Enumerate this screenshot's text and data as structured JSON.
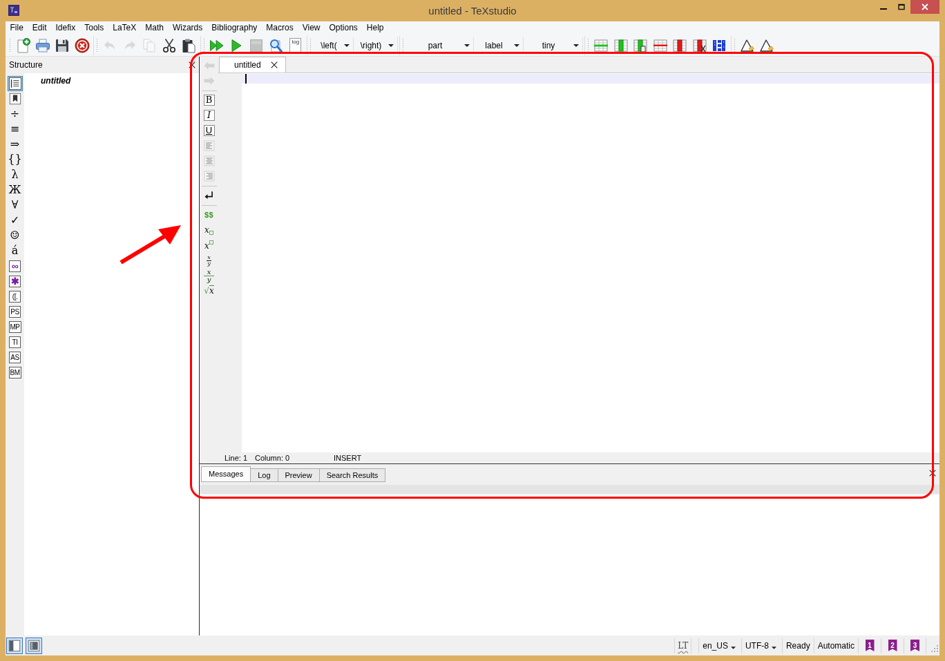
{
  "window": {
    "title": "untitled - TeXstudio"
  },
  "menu": [
    "File",
    "Edit",
    "Idefix",
    "Tools",
    "LaTeX",
    "Math",
    "Wizards",
    "Bibliography",
    "Macros",
    "View",
    "Options",
    "Help"
  ],
  "toolbar": [
    {
      "buttons": [
        {
          "kind": "new",
          "disabled": false
        },
        {
          "kind": "print",
          "disabled": false
        },
        {
          "kind": "save",
          "disabled": false
        },
        {
          "kind": "close",
          "disabled": false
        }
      ]
    },
    {
      "buttons": [
        {
          "kind": "undo",
          "disabled": true
        },
        {
          "kind": "redo",
          "disabled": true
        },
        {
          "kind": "copy",
          "disabled": true
        },
        {
          "kind": "cut",
          "disabled": false
        },
        {
          "kind": "paste",
          "disabled": false
        }
      ]
    },
    {
      "buttons": [
        {
          "kind": "compile",
          "disabled": false
        },
        {
          "kind": "build",
          "disabled": false
        },
        {
          "kind": "stop",
          "disabled": true
        },
        {
          "kind": "view",
          "disabled": false
        },
        {
          "kind": "log",
          "text": "log",
          "disabled": false
        }
      ]
    },
    {
      "dropdowns": [
        "\\left(",
        "\\right)"
      ]
    },
    {
      "dropdowns": [
        "part",
        "label",
        "tiny"
      ]
    },
    {
      "buttons": [
        {
          "kind": "add-row",
          "disabled": false
        },
        {
          "kind": "add-column",
          "disabled": false
        },
        {
          "kind": "paste-column",
          "disabled": false
        },
        {
          "kind": "remove-row",
          "disabled": false
        },
        {
          "kind": "remove-column",
          "disabled": false
        },
        {
          "kind": "cut-column",
          "disabled": false
        },
        {
          "kind": "align-columns",
          "disabled": false
        }
      ]
    },
    {
      "buttons": [
        {
          "kind": "triangle",
          "disabled": false
        },
        {
          "kind": "triangle",
          "disabled": false
        }
      ]
    }
  ],
  "structure": {
    "title": "Structure",
    "tabs": [
      {
        "kind": "outline",
        "selected": true
      },
      {
        "kind": "bookmark",
        "selected": false
      },
      {
        "kind": "glyph",
        "text": "÷",
        "selected": false
      },
      {
        "kind": "glyph",
        "text": "≡",
        "selected": false
      },
      {
        "kind": "glyph",
        "text": "⇒",
        "selected": false
      },
      {
        "kind": "glyph",
        "text": "{}",
        "selected": false
      },
      {
        "kind": "glyph",
        "text": "λ",
        "selected": false
      },
      {
        "kind": "glyph",
        "text": "Ж",
        "selected": false
      },
      {
        "kind": "glyph",
        "text": "∀",
        "selected": false
      },
      {
        "kind": "glyph",
        "text": "✓",
        "selected": false
      },
      {
        "kind": "glyph",
        "text": "☺",
        "selected": false
      },
      {
        "kind": "glyph",
        "text": "á",
        "selected": false
      },
      {
        "kind": "accent",
        "text": "∞",
        "selected": false
      },
      {
        "kind": "accent",
        "text": "✱",
        "selected": false
      },
      {
        "kind": "boxed",
        "text": "([.",
        "selected": false
      },
      {
        "kind": "boxed",
        "text": "PS",
        "selected": false
      },
      {
        "kind": "boxed",
        "text": "MP",
        "selected": false
      },
      {
        "kind": "boxed",
        "text": "TI",
        "selected": false
      },
      {
        "kind": "boxed",
        "text": "AS",
        "selected": false
      },
      {
        "kind": "boxed",
        "text": "BM",
        "selected": false
      }
    ],
    "tree": [
      {
        "label": "untitled"
      }
    ]
  },
  "editor": {
    "tabs": [
      {
        "label": "untitled",
        "selected": true
      }
    ],
    "toolbar": [
      {
        "items": [
          {
            "kind": "back",
            "disabled": true
          },
          {
            "kind": "forward",
            "disabled": true
          }
        ]
      },
      {
        "items": [
          {
            "kind": "bold",
            "text": "B"
          },
          {
            "kind": "italic",
            "text": "I"
          },
          {
            "kind": "underline",
            "text": "U"
          },
          {
            "kind": "align-left"
          },
          {
            "kind": "align-center"
          },
          {
            "kind": "align-right"
          }
        ]
      },
      {
        "items": [
          {
            "kind": "newline"
          }
        ]
      },
      {
        "items": [
          {
            "kind": "math",
            "text": "$$"
          },
          {
            "kind": "subscript",
            "text": "x"
          },
          {
            "kind": "superscript",
            "text": "x"
          },
          {
            "kind": "fraction-inline",
            "numerator": "x",
            "denominator": "y"
          },
          {
            "kind": "fraction",
            "numerator": "x",
            "denominator": "y"
          },
          {
            "kind": "sqrt",
            "sign": "√",
            "text": "x"
          }
        ]
      }
    ],
    "status": {
      "line": "Line: 1",
      "column": "Column: 0",
      "mode": "INSERT"
    }
  },
  "messages": {
    "tabs": [
      {
        "label": "Messages",
        "selected": true
      },
      {
        "label": "Log",
        "selected": false
      },
      {
        "label": "Preview",
        "selected": false
      },
      {
        "label": "Search Results",
        "selected": false
      }
    ]
  },
  "status_bar": {
    "panel_toggles": [
      {
        "kind": "sidebar",
        "checked": true
      },
      {
        "kind": "viewer",
        "checked": true
      }
    ],
    "languagetool": "LT",
    "language": "en_US",
    "encoding": "UTF-8",
    "state": "Ready",
    "mode": "Automatic",
    "bookmarks": [
      "1",
      "2",
      "3"
    ]
  },
  "annotation": {
    "kind": "frame-with-arrow"
  }
}
